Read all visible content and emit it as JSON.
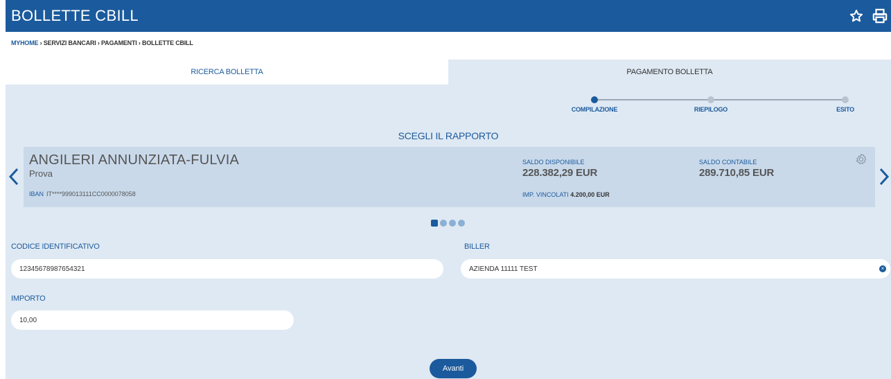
{
  "header": {
    "title": "BOLLETTE CBILL",
    "favorite_icon": "star-icon",
    "print_icon": "print-icon"
  },
  "breadcrumb": {
    "items": [
      "MYHOME",
      "SERVIZI BANCARI",
      "PAGAMENTI",
      "BOLLETTE CBILL"
    ],
    "separator": "›"
  },
  "tabs": [
    {
      "label": "RICERCA BOLLETTA"
    },
    {
      "label": "PAGAMENTO BOLLETTA"
    }
  ],
  "stepper": {
    "steps": [
      "COMPILAZIONE",
      "RIEPILOGO",
      "ESITO"
    ],
    "active": 0
  },
  "account_section": {
    "title": "SCEGLI IL RAPPORTO",
    "card": {
      "name": "ANGILERI ANNUNZIATA-FULVIA",
      "subtitle": "Prova",
      "iban_label": "IBAN",
      "iban_value": "IT****999013111CC0000078058",
      "saldo_disponibile_label": "SALDO DISPONIBILE",
      "saldo_disponibile_value": "228.382,29 EUR",
      "saldo_contabile_label": "SALDO CONTABILE",
      "saldo_contabile_value": "289.710,85 EUR",
      "vincolati_label": "IMP. VINCOLATI",
      "vincolati_value": "4.200,00 EUR"
    },
    "pager": {
      "count": 4,
      "active": 0
    }
  },
  "form": {
    "codice_label": "CODICE IDENTIFICATIVO",
    "codice_value": "12345678987654321",
    "biller_label": "BILLER",
    "biller_value": "AZIENDA 11111 TEST",
    "importo_label": "IMPORTO",
    "importo_value": "10,00",
    "submit_label": "Avanti"
  },
  "colors": {
    "brand": "#1b5a9c",
    "panel": "#dfe9f3",
    "card": "#c9d9ea"
  }
}
